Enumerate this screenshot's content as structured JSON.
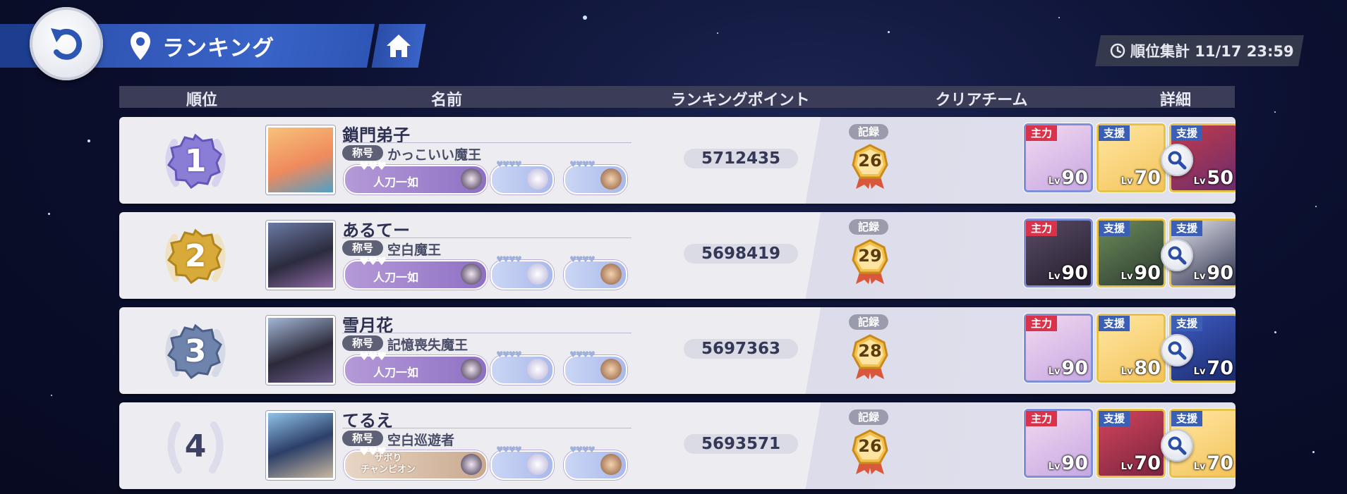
{
  "header": {
    "title": "ランキング",
    "deadline": "順位集計 11/17 23:59"
  },
  "columns": {
    "rank": "順位",
    "name": "名前",
    "points": "ランキングポイント",
    "team": "クリアチーム",
    "detail": "詳細"
  },
  "labels": {
    "title_tag": "称号",
    "record_tag": "記録",
    "main": "主力",
    "support": "支援",
    "lv": "Lv"
  },
  "rows": [
    {
      "rank": "1",
      "name": "鎖門弟子",
      "title": "かっこいい魔王",
      "achievement": "人刀一如",
      "points": "5712435",
      "record": "26",
      "team": [
        {
          "role": "主力",
          "level": "90"
        },
        {
          "role": "支援",
          "level": "70"
        },
        {
          "role": "支援",
          "level": "50"
        }
      ]
    },
    {
      "rank": "2",
      "name": "あるてー",
      "title": "空白魔王",
      "achievement": "人刀一如",
      "points": "5698419",
      "record": "29",
      "team": [
        {
          "role": "主力",
          "level": "90"
        },
        {
          "role": "支援",
          "level": "90"
        },
        {
          "role": "支援",
          "level": "90"
        }
      ]
    },
    {
      "rank": "3",
      "name": "雪月花",
      "title": "記憶喪失魔王",
      "achievement": "人刀一如",
      "points": "5697363",
      "record": "28",
      "team": [
        {
          "role": "主力",
          "level": "90"
        },
        {
          "role": "支援",
          "level": "80"
        },
        {
          "role": "支援",
          "level": "70"
        }
      ]
    },
    {
      "rank": "4",
      "name": "てるえ",
      "title": "空白巡遊者",
      "achievement": "サボり\nチャンピオン",
      "points": "5693571",
      "record": "26",
      "team": [
        {
          "role": "主力",
          "level": "90"
        },
        {
          "role": "支援",
          "level": "70"
        },
        {
          "role": "支援",
          "level": "70"
        }
      ]
    }
  ]
}
